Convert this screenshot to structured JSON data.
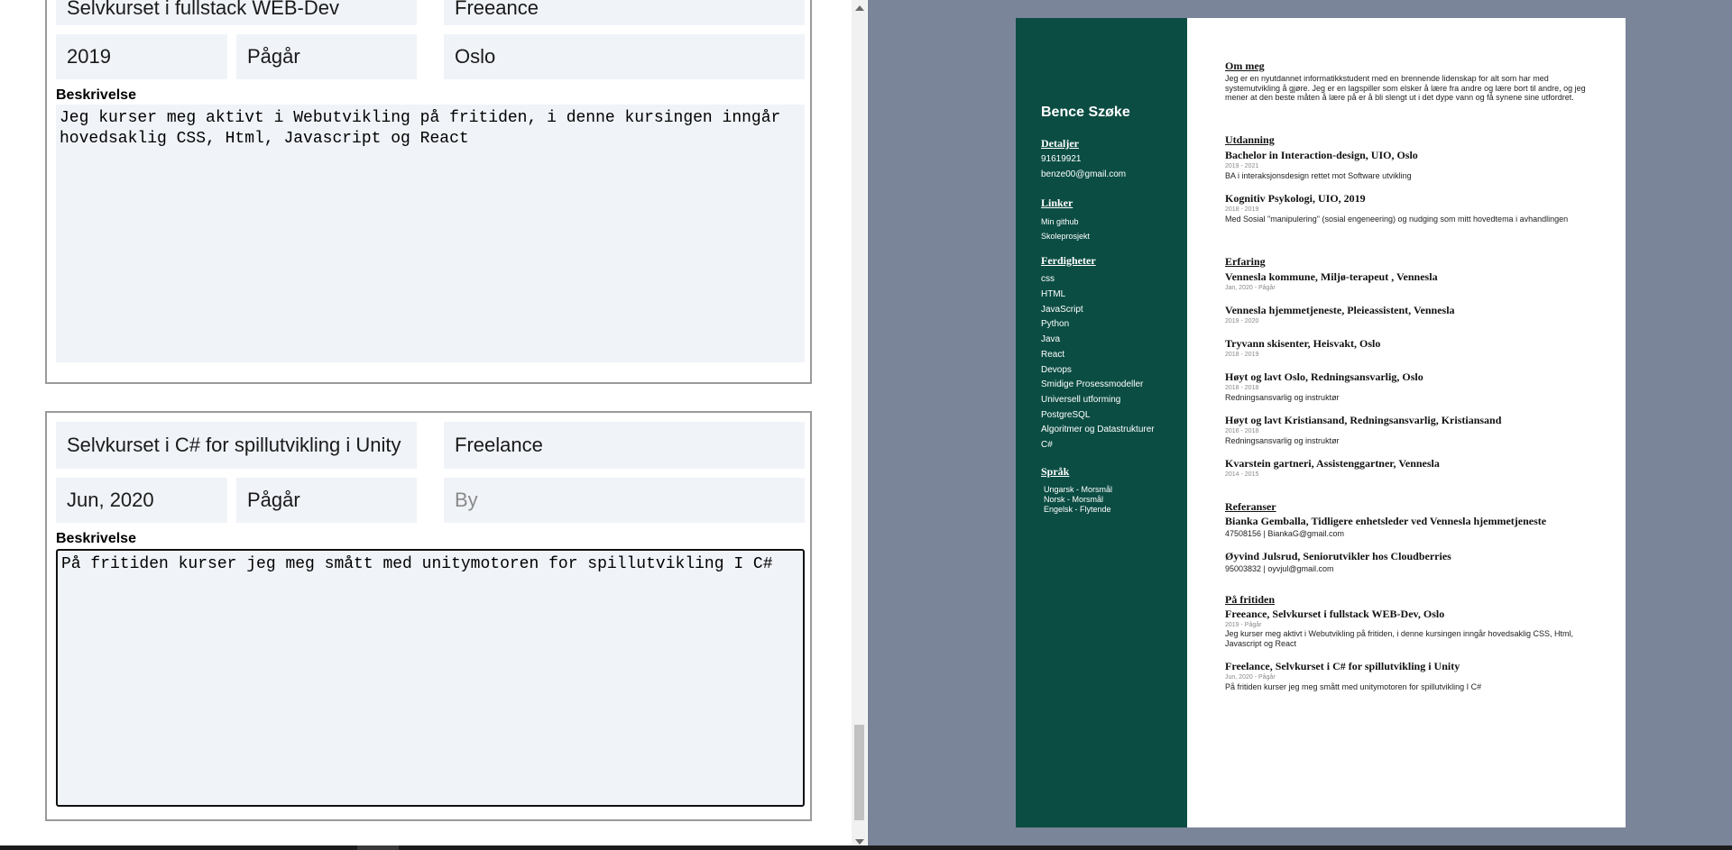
{
  "editor": {
    "card1": {
      "title": "Selvkurset i fullstack WEB-Dev",
      "employer": "Freeance",
      "start": "2019",
      "end": "Pågår",
      "city": "Oslo",
      "desc_label": "Beskrivelse",
      "description": "Jeg kurser meg aktivt i Webutvikling på fritiden, i denne kursingen inngår hovedsaklig CSS, Html, Javascript og React"
    },
    "card2": {
      "title": "Selvkurset i C# for spillutvikling i Unity",
      "employer": "Freelance",
      "start": "Jun, 2020",
      "end": "Pågår",
      "city_placeholder": "By",
      "desc_label": "Beskrivelse",
      "description": "På fritiden kurser jeg meg smått med unitymotoren for spillutvikling I C#"
    }
  },
  "cv": {
    "name": "Bence Szøke",
    "sidebar": {
      "details_head": "Detaljer",
      "phone": "91619921",
      "email": "benze00@gmail.com",
      "links_head": "Linker",
      "links": [
        "Min github",
        "Skoleprosjekt"
      ],
      "skills_head": "Ferdigheter",
      "skills": [
        "css",
        "HTML",
        "JavaScript",
        "Python",
        "Java",
        "React",
        "Devops",
        "Smidige Prosessmodeller",
        "Universell utforming",
        "PostgreSQL",
        "Algoritmer og Datastrukturer",
        "C#"
      ],
      "lang_head": "Språk",
      "languages": [
        "Ungarsk - Morsmål",
        "Norsk - Morsmål",
        "Engelsk - Flytende"
      ]
    },
    "about": {
      "head": "Om meg",
      "text": "Jeg er en nyutdannet informatikkstudent med en brennende lidenskap for alt som har med systemutvikling å gjøre. Jeg er en lagspiller som elsker å lære fra andre og lære bort til andre, og jeg mener at den beste måten å lære på er å bli slengt ut i det dype vann og få synene sine utfordret."
    },
    "education": {
      "head": "Utdanning",
      "items": [
        {
          "title": "Bachelor in Interaction-design, UIO, Oslo",
          "date": "2019 - 2021",
          "text": "BA i interaksjonsdesign rettet mot Software utvikling"
        },
        {
          "title": "Kognitiv Psykologi, UIO, 2019",
          "date": "2018 - 2019",
          "text": "Med Sosial \"manipulering\" (sosial engeneering) og nudging som mitt hovedtema i avhandlingen"
        }
      ]
    },
    "experience": {
      "head": "Erfaring",
      "items": [
        {
          "title": "Vennesla kommune, Miljø-terapeut , Vennesla",
          "date": "Jan, 2020 - Pågår",
          "text": ""
        },
        {
          "title": "Vennesla hjemmetjeneste, Pleieassistent, Vennesla",
          "date": "2019 - 2020",
          "text": ""
        },
        {
          "title": "Tryvann skisenter, Heisvakt, Oslo",
          "date": "2018 - 2019",
          "text": ""
        },
        {
          "title": "Høyt og lavt Oslo, Redningsansvarlig, Oslo",
          "date": "2018 - 2018",
          "text": "Redningsansvarlig og instruktør"
        },
        {
          "title": "Høyt og lavt Kristiansand, Redningsansvarlig, Kristiansand",
          "date": "2016 - 2018",
          "text": "Redningsansvarlig og instruktør"
        },
        {
          "title": "Kvarstein gartneri, Assistenggartner, Vennesla",
          "date": "2014 - 2015",
          "text": ""
        }
      ]
    },
    "references": {
      "head": "Referanser",
      "items": [
        {
          "title": "Bianka Gemballa, Tidligere enhetsleder ved Vennesla hjemmetjeneste",
          "text": "47508156 | BiankaG@gmail.com"
        },
        {
          "title": "Øyvind Julsrud, Seniorutvikler hos Cloudberries",
          "text": "95003832 | oyvjul@gmail.com"
        }
      ]
    },
    "leisure": {
      "head": "På fritiden",
      "items": [
        {
          "title": "Freeance, Selvkurset i fullstack WEB-Dev, Oslo",
          "date": "2019 - Pågår",
          "text": "Jeg kurser meg aktivt i Webutvikling på fritiden, i denne kursingen inngår hovedsaklig CSS, Html, Javascript og React"
        },
        {
          "title": "Freelance, Selvkurset i C# for spillutvikling i Unity",
          "date": "Jun, 2020 - Pågår",
          "text": "På fritiden kurser jeg meg smått med unitymotoren for spillutvikling I C#"
        }
      ]
    }
  },
  "colors": {
    "sidebar": "#0b4d43",
    "preview_bg": "#7b8599",
    "field_bg": "#f0f3f8"
  }
}
